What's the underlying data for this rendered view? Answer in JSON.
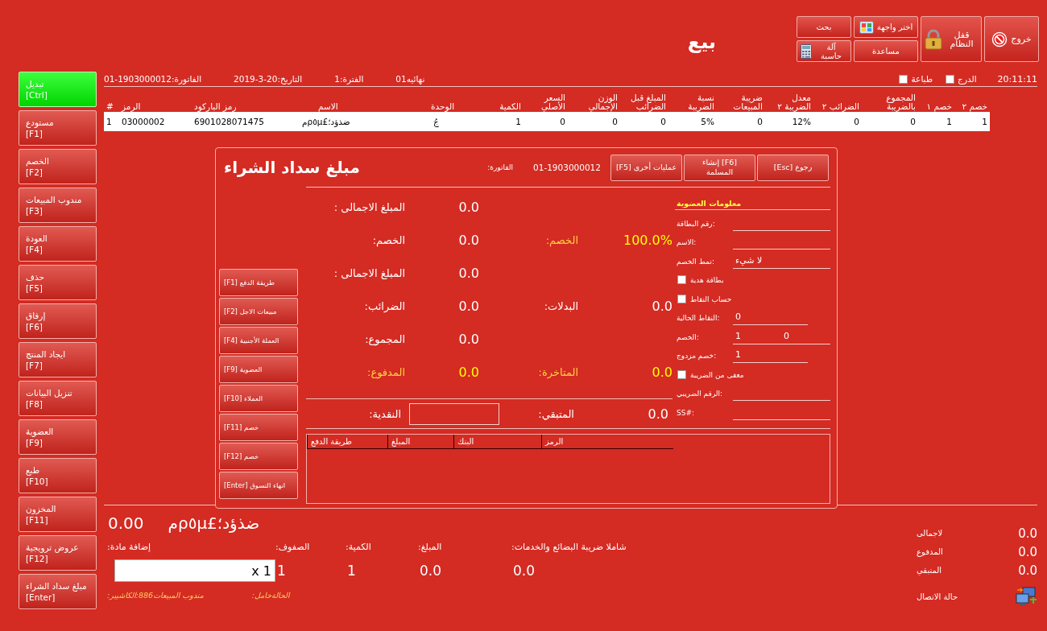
{
  "window": {
    "title": "بيع",
    "clock": "20:11:11"
  },
  "toolbar_buttons": [
    {
      "label": "بحث",
      "kind": "small"
    },
    {
      "label": "آلة حاسبة",
      "kind": "small"
    },
    {
      "label": "اختر واجهة",
      "kind": "small"
    },
    {
      "label": "مساعدة",
      "kind": "small"
    },
    {
      "label": "قفل النظام",
      "kind": "tall"
    },
    {
      "label": "خروج",
      "kind": "tall"
    }
  ],
  "options": [
    {
      "label": "الدرج",
      "checked": false
    },
    {
      "label": "طباعة",
      "checked": false
    }
  ],
  "info": [
    "01نهائيه",
    "1:الفترة",
    "2019-3-20:التاريخ",
    "01-1903000012:الفاتورة"
  ],
  "sidebar": {
    "items": [
      {
        "label": "تبديل\n[Ctrl]",
        "selected": true
      },
      {
        "label": "مستودع\n[F1]",
        "selected": false
      },
      {
        "label": "الخصم\n[F2]",
        "selected": false
      },
      {
        "label": "مندوب المبيعات\n[F3]",
        "selected": false
      },
      {
        "label": "العودة\n[F4]",
        "selected": false
      },
      {
        "label": "حذف\n[F5]",
        "selected": false
      },
      {
        "label": "إرفاق\n[F6]",
        "selected": false
      },
      {
        "label": "ايجاد المنتج\n[F7]",
        "selected": false
      },
      {
        "label": "تنزيل البيانات\n[F8]",
        "selected": false
      },
      {
        "label": "العضوية\n[F9]",
        "selected": false
      },
      {
        "label": "طبع\n[F10]",
        "selected": false
      },
      {
        "label": "المخزون\n[F11]",
        "selected": false
      },
      {
        "label": "عروض ترويجية\n[F12]",
        "selected": false
      },
      {
        "label": "مبلغ سداد الشراء\n[Enter]",
        "selected": false
      }
    ]
  },
  "table": {
    "columns": [
      "خصم ٢",
      "خصم ١",
      "المجموع بالضريبة",
      "الضرائب ٢",
      "معدل الضريبة ٢",
      "ضريبة المبيعات",
      "نسبة الضريبة",
      "المبلغ قبل الضرائب",
      "الوزن الإجمالي",
      "السعر الأصلي",
      "الكمية",
      "الوحدة",
      "الاسم",
      "رمز الباركود",
      "الرمز",
      "#"
    ],
    "rows": [
      [
        "1",
        "1",
        "0",
        "0",
        "12%",
        "0",
        "5%",
        "0",
        "0",
        "0",
        "1",
        "جُ",
        "مρ٥µ£ضذؤد؛",
        "6901028071475",
        "03000002",
        "1"
      ]
    ]
  },
  "dialog": {
    "title": "مبلغ سداد الشراء",
    "invoice_label": ":الفاتورة",
    "invoice": "01-1903000012",
    "buttons": [
      "[Esc] رجوع",
      "إنشاء [F6]\nالمسلمة",
      "[F5] عمليات أخرى"
    ],
    "actions": [
      "[F1] طريقة الدفع",
      "[F2] مبيعات الاجل",
      "[F4] العملة الأجنبية",
      "[F9] العضوية",
      "[F10] العملاء",
      "[F11] خصم",
      "[F12] خصم",
      "[Enter] انهاء التسوق"
    ],
    "summary": [
      {
        "cells": [
          {
            "kind": "value",
            "text": "0.0",
            "highlight": false
          },
          {
            "kind": "label",
            "text": ": المبلغ الاجمالى",
            "highlight": false
          }
        ]
      },
      {
        "cells": [
          {
            "kind": "value",
            "text": "100.0%",
            "highlight": true
          },
          {
            "kind": "label",
            "text": ":الخصم",
            "highlight": true
          },
          {
            "kind": "value",
            "text": "0.0",
            "highlight": false
          },
          {
            "kind": "label",
            "text": ":الخصم",
            "highlight": false
          }
        ]
      },
      {
        "cells": [
          {
            "kind": "value",
            "text": "0.0",
            "highlight": false
          },
          {
            "kind": "label",
            "text": ": المبلغ الاجمالى",
            "highlight": false
          }
        ]
      },
      {
        "cells": [
          {
            "kind": "value",
            "text": "0.0",
            "highlight": false
          },
          {
            "kind": "label",
            "text": ":البدلات",
            "highlight": false
          },
          {
            "kind": "value",
            "text": "0.0",
            "highlight": false
          },
          {
            "kind": "label",
            "text": ":الضرائب",
            "highlight": false
          }
        ]
      },
      {
        "cells": [
          {
            "kind": "value",
            "text": "0.0",
            "highlight": false
          },
          {
            "kind": "label",
            "text": ":المجموع",
            "highlight": false
          }
        ]
      },
      {
        "cells": [
          {
            "kind": "value",
            "text": "0.0",
            "highlight": true
          },
          {
            "kind": "label",
            "text": ":المتاخرة",
            "highlight": true
          },
          {
            "kind": "value",
            "text": "0.0",
            "highlight": true
          },
          {
            "kind": "label",
            "text": ":المدفوع",
            "highlight": true
          }
        ]
      }
    ],
    "cash_label": ":النقدية",
    "remaining_label": ":المتبقي",
    "remaining": "0.0",
    "membership": {
      "title": "معلومات العضوية",
      "fields": [
        {
          "kind": "field",
          "label": "رقم البطاقة:"
        },
        {
          "kind": "field",
          "label": "الاسم:"
        },
        {
          "kind": "field",
          "label": "نمط الخصم:",
          "value": "لا شيء"
        },
        {
          "kind": "checkbox",
          "label": "بطاقة هدية",
          "checked": false
        },
        {
          "kind": "checkbox",
          "label": "حساب النقاط",
          "checked": false
        },
        {
          "kind": "short_field",
          "label": "النقاط الحالية:",
          "value": "0"
        },
        {
          "kind": "pair",
          "label": "الخصم:",
          "values": [
            "0",
            "1"
          ]
        },
        {
          "kind": "short_field",
          "label": "خصم مزدوج:",
          "value": "1"
        },
        {
          "kind": "checkbox",
          "label": "معفى من الضريبة",
          "checked": false
        },
        {
          "kind": "field",
          "label": "الرقم الضريبي:"
        },
        {
          "kind": "field",
          "label": "SS#:"
        }
      ]
    },
    "payments": {
      "columns": [
        "الرمز",
        "البنك",
        "المبلغ",
        "طريقة الدفع"
      ]
    }
  },
  "bottom": {
    "total": "0.00",
    "item_name": "مρ٥µ£ضذؤد؛",
    "add_item": {
      "label": ":إضافة مادة",
      "value": "x 1"
    },
    "figures": [
      {
        "label": ":شاملا ضريبة البضائع والخدمات",
        "value": "0.0"
      },
      {
        "label": ":المبلغ",
        "value": "0.0"
      },
      {
        "label": ":الكمية",
        "value": "1"
      },
      {
        "label": ":الصفوف",
        "value": "1"
      }
    ],
    "status": [
      ":الحالةخامل",
      ":مندوب المبيعات886:الكاشيير"
    ]
  },
  "totals": [
    {
      "label": "لاجمالى",
      "value": "0.0"
    },
    {
      "label": "المدفوع",
      "value": "0.0"
    },
    {
      "label": "المتبقي",
      "value": "0.0"
    }
  ],
  "connection": {
    "label": "حالة الاتصال"
  }
}
